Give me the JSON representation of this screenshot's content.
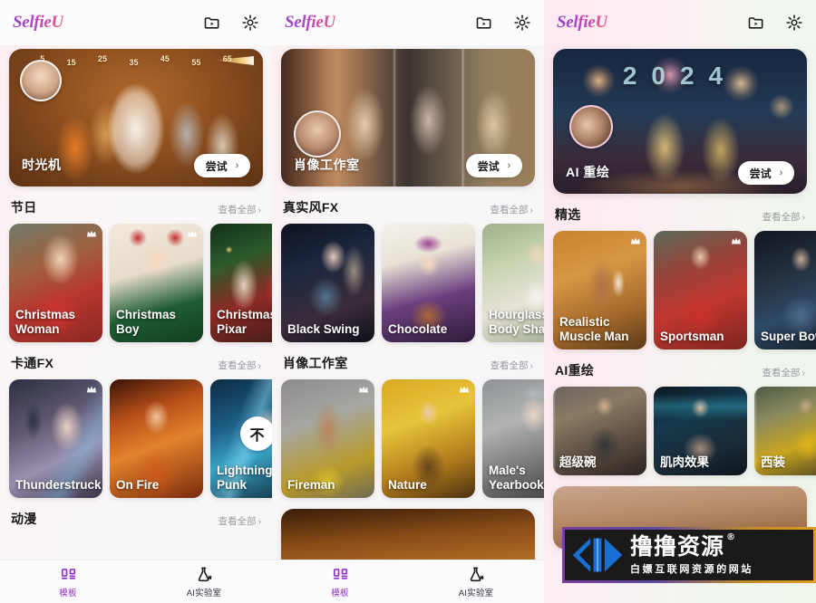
{
  "app": {
    "logo_text": "SelfieU",
    "accent_color": "#9130c9",
    "brand_gradient": [
      "#8d46c8",
      "#e05a8c"
    ]
  },
  "header": {
    "icons": [
      {
        "name": "video-folder-icon",
        "label": "video-folder"
      },
      {
        "name": "gear-icon",
        "label": "settings"
      }
    ]
  },
  "panels": [
    {
      "id": "panel-1",
      "hero": {
        "label": "时光机",
        "button": "尝试",
        "chevron": "›",
        "ruler_ticks": [
          "5",
          "15",
          "25",
          "35",
          "45",
          "55",
          "65"
        ]
      },
      "sections": [
        {
          "title": "节日",
          "more": "查看全部",
          "cards": [
            {
              "name": "Christmas Woman",
              "crown": true,
              "locked": false
            },
            {
              "name": "Christmas Boy",
              "crown": true,
              "locked": false
            },
            {
              "name": "Christmas Pixar",
              "crown": false,
              "locked": false
            }
          ]
        },
        {
          "title": "卡通FX",
          "more": "查看全部",
          "cards": [
            {
              "name": "Thunderstruck",
              "crown": true,
              "locked": false
            },
            {
              "name": "On Fire",
              "crown": false,
              "locked": false
            },
            {
              "name": "Lightning Punk",
              "crown": false,
              "locked": true,
              "lock_glyph": "不"
            }
          ]
        },
        {
          "title": "动漫",
          "more": "查看全部",
          "cards": []
        }
      ]
    },
    {
      "id": "panel-2",
      "hero": {
        "label": "肖像工作室",
        "button": "尝试",
        "chevron": "›"
      },
      "sections": [
        {
          "title": "真实风FX",
          "more": "查看全部",
          "cards": [
            {
              "name": "Black Swing",
              "crown": false,
              "locked": false
            },
            {
              "name": "Chocolate",
              "crown": false,
              "locked": false
            },
            {
              "name": "Hourglass Body Shape",
              "crown": false,
              "locked": false
            }
          ]
        },
        {
          "title": "肖像工作室",
          "more": "查看全部",
          "cards": [
            {
              "name": "Fireman",
              "crown": true,
              "locked": false
            },
            {
              "name": "Nature",
              "crown": true,
              "locked": false
            },
            {
              "name": "Male's Yearbook",
              "crown": false,
              "locked": false
            }
          ]
        }
      ]
    },
    {
      "id": "panel-3",
      "hero": {
        "label": "AI 重绘",
        "button": "尝试",
        "chevron": "›",
        "year": "2024"
      },
      "sections": [
        {
          "title": "精选",
          "more": "查看全部",
          "cards": [
            {
              "name": "Realistic Muscle Man",
              "crown": true,
              "locked": false
            },
            {
              "name": "Sportsman",
              "crown": true,
              "locked": false
            },
            {
              "name": "Super Bowl",
              "crown": false,
              "locked": false
            }
          ]
        },
        {
          "title": "AI重绘",
          "more": "查看全部",
          "cards": [
            {
              "name": "超级碗",
              "crown": false,
              "locked": false
            },
            {
              "name": "肌肉效果",
              "crown": false,
              "locked": false
            },
            {
              "name": "西装",
              "crown": false,
              "locked": false
            }
          ]
        }
      ]
    }
  ],
  "tabbar": {
    "tabs": [
      {
        "label": "模板",
        "icon": "template-icon",
        "active": true
      },
      {
        "label": "AI实验室",
        "icon": "flask-icon",
        "active": false
      }
    ]
  },
  "watermark": {
    "main": "撸撸资源",
    "registered": "®",
    "sub": "白嫖互联网资源的网站"
  }
}
